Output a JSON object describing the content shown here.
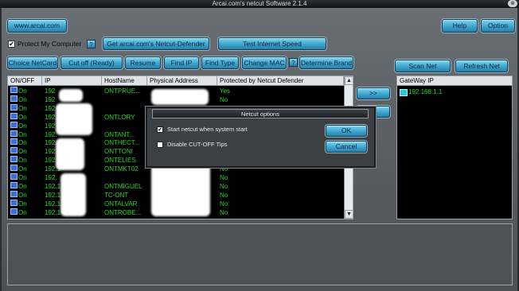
{
  "window": {
    "title": "Arcai.com's netcut Software 2.1.4"
  },
  "toolbar": {
    "site_button": "www.arcai.com",
    "help": "Help",
    "option": "Option",
    "protect_label": "Protect My Computer",
    "protect_checked": "✔",
    "help_q": "?",
    "defender_button": "Get arcai.com's Netcut-Defender",
    "speed_button": "Test Internet Speed"
  },
  "actions": {
    "choice": "Choice NetCard",
    "cutoff": "Cut off (Ready)",
    "resume": "Resume",
    "find_ip": "Find IP",
    "find_type": "Find Type",
    "change_mac": "Change MAC",
    "q": "?",
    "brand": "Determine Brand",
    "scan": "Scan Net",
    "refresh": "Refresh Net",
    "move_right": ">>",
    "move_left": "<<"
  },
  "list": {
    "headers": [
      "ON/OFF",
      "IP",
      "HostName",
      "Physical Address",
      "Protected by Netcut Defender"
    ],
    "rows": [
      {
        "state": "On",
        "ip": "192",
        "host": "ONTPRUE...",
        "prot": "Yes"
      },
      {
        "state": "On",
        "ip": "192",
        "host": "",
        "prot": "No"
      },
      {
        "state": "On",
        "ip": "192",
        "host": "",
        "prot": ""
      },
      {
        "state": "On",
        "ip": "192.",
        "host": "ONTLORY",
        "prot": ""
      },
      {
        "state": "On",
        "ip": "192",
        "host": "",
        "prot": ""
      },
      {
        "state": "On",
        "ip": "192.",
        "host": "ONTANT...",
        "prot": ""
      },
      {
        "state": "On",
        "ip": "192.",
        "host": "ONTHECT...",
        "prot": ""
      },
      {
        "state": "On",
        "ip": "192.1",
        "host": "ONTTONI",
        "prot": ""
      },
      {
        "state": "On",
        "ip": "192.",
        "host": "ONTELIES",
        "prot": ""
      },
      {
        "state": "On",
        "ip": "192.1",
        "host": "ONTMKT02",
        "prot": "No"
      },
      {
        "state": "On",
        "ip": "192.",
        "host": "",
        "prot": "No"
      },
      {
        "state": "On",
        "ip": "192.1",
        "host": "ONTMIGUEL",
        "prot": "No"
      },
      {
        "state": "On",
        "ip": "192.1",
        "host": "TC-ONT",
        "prot": "No"
      },
      {
        "state": "On",
        "ip": "192.1",
        "host": "ONTALVAR",
        "prot": "No"
      },
      {
        "state": "On",
        "ip": "192.1",
        "host": "ONTROBE...",
        "prot": "No"
      }
    ]
  },
  "gateway": {
    "header": "GateWay IP",
    "ip": "192.168.1.1"
  },
  "dialog": {
    "title": "Netcut options",
    "opt1": "Start netcut when system start",
    "opt1_check": "✔",
    "opt2": "Disable CUT-OFF Tips",
    "ok": "OK",
    "cancel": "Cancel"
  },
  "scroll": {
    "up": "▲",
    "down": "▼"
  }
}
